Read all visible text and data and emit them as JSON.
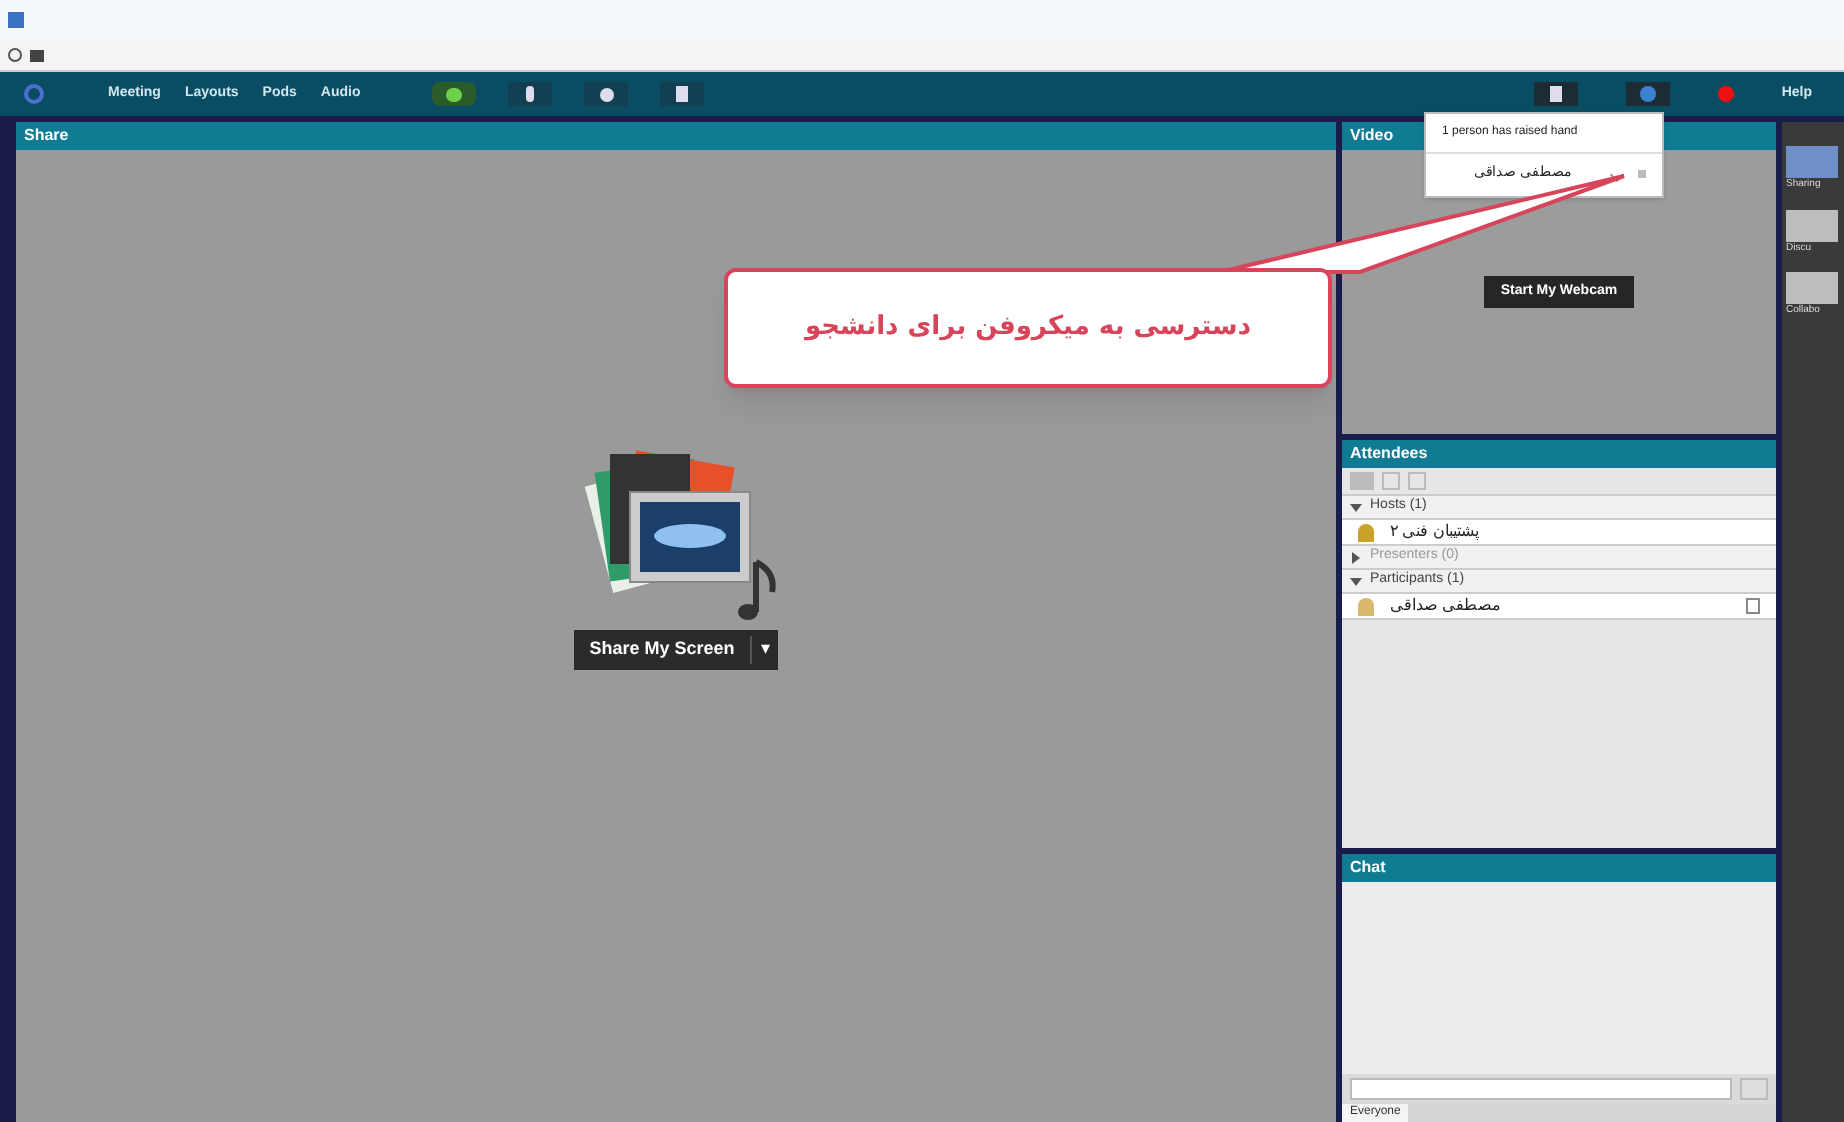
{
  "menu": [
    "Meeting",
    "Layouts",
    "Pods",
    "Audio"
  ],
  "help": "Help",
  "share_pod": {
    "title": "Share",
    "button": "Share My Screen",
    "button_caret": "▾"
  },
  "video_pod": {
    "title": "Video",
    "button": "Start My Webcam"
  },
  "hand_popup": {
    "header": "1 person has raised hand",
    "rows": [
      {
        "name": "مصطفی صداقی"
      }
    ]
  },
  "callout": "دسترسی به میکروفن برای دانشجو",
  "attendees": {
    "title": "Attendees",
    "groups": [
      {
        "label": "Hosts (1)",
        "expanded": true,
        "people": [
          {
            "name": "پشتیبان فنی ۲",
            "kind": "host"
          }
        ]
      },
      {
        "label": "Presenters (0)",
        "expanded": false
      },
      {
        "label": "Participants (1)",
        "expanded": true,
        "people": [
          {
            "name": "مصطفی صداقی",
            "kind": "participant"
          }
        ]
      }
    ]
  },
  "chat": {
    "title": "Chat",
    "tab": "Everyone"
  },
  "layouts": [
    {
      "label": "Sharing",
      "selected": true
    },
    {
      "label": "Discu",
      "selected": false
    },
    {
      "label": "Collabo",
      "selected": false
    }
  ]
}
